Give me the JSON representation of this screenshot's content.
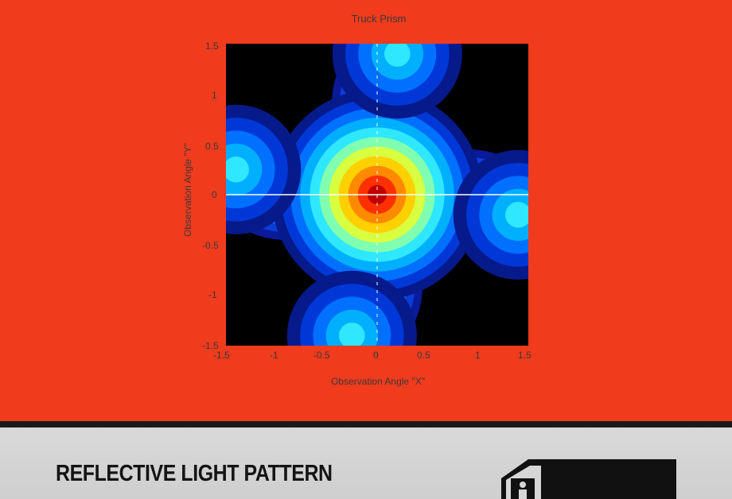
{
  "slide": {
    "background_color": "#f13b1d"
  },
  "chart_data": {
    "type": "heatmap",
    "title": "Truck Prism",
    "xlabel": "Observation Angle \"X\"",
    "ylabel": "Observation Angle \"Y\"",
    "xlim": [
      -1.5,
      1.5
    ],
    "ylim": [
      -1.5,
      1.5
    ],
    "x_ticks": [
      "-1.5",
      "-1",
      "-0.5",
      "0",
      "0.5",
      "1",
      "1.5"
    ],
    "y_ticks": [
      "1.5",
      "1",
      "0.5",
      "0",
      "-0.5",
      "-1",
      "-1.5"
    ],
    "colormap": "jet",
    "background": "#000000",
    "peaks": [
      {
        "x": 0.0,
        "y": 0.0,
        "intensity": 1.0
      },
      {
        "x": 0.2,
        "y": 1.4,
        "intensity": 0.42
      },
      {
        "x": -0.25,
        "y": -1.4,
        "intensity": 0.42
      },
      {
        "x": -1.4,
        "y": 0.25,
        "intensity": 0.42
      },
      {
        "x": 1.4,
        "y": -0.2,
        "intensity": 0.42
      }
    ],
    "crosshair": true
  },
  "footer": {
    "title": "REFLECTIVE LIGHT PATTERN",
    "icon": "truck-icon"
  }
}
